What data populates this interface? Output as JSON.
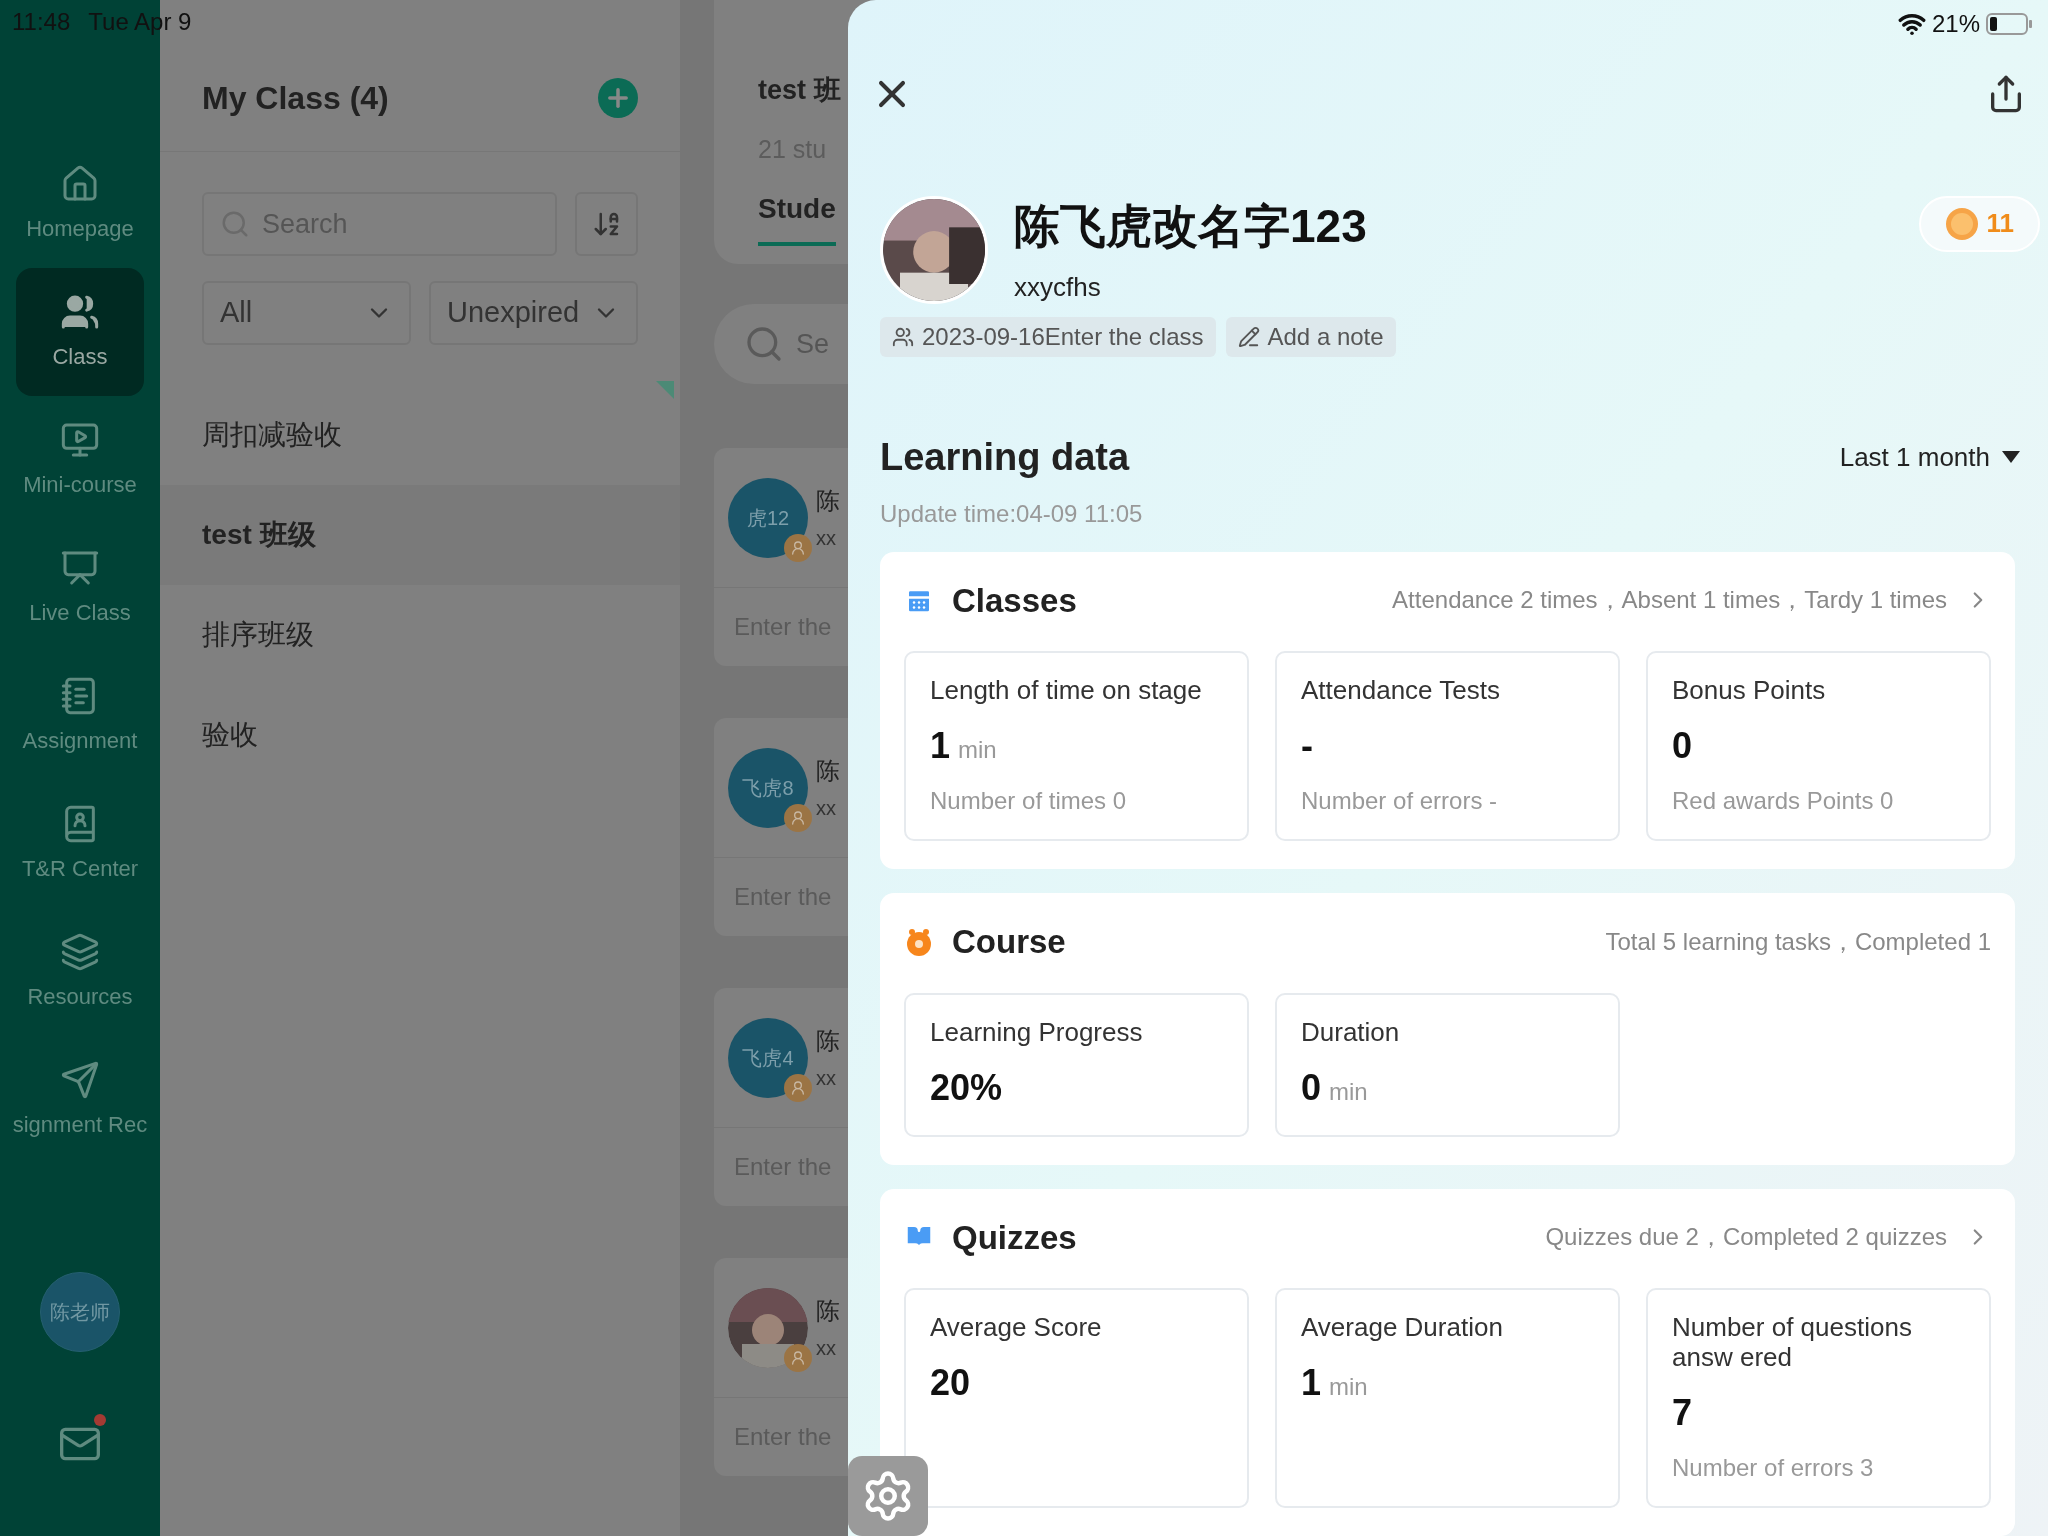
{
  "status_bar": {
    "time": "11:48",
    "date": "Tue Apr 9",
    "battery_text": "21%"
  },
  "sidebar": {
    "items": [
      {
        "label": "Homepage",
        "selected": false
      },
      {
        "label": "Class",
        "selected": true
      },
      {
        "label": "Mini-course",
        "selected": false
      },
      {
        "label": "Live Class",
        "selected": false
      },
      {
        "label": "Assignment",
        "selected": false
      },
      {
        "label": "T&R Center",
        "selected": false
      },
      {
        "label": "Resources",
        "selected": false
      },
      {
        "label": "signment Rec",
        "selected": false
      }
    ],
    "user": "陈老师",
    "mail_unread": true
  },
  "class_list": {
    "title": "My Class (4)",
    "search": {
      "placeholder": "Search"
    },
    "filters": [
      "All",
      "Unexpired"
    ],
    "items": [
      {
        "label": "周扣减验收",
        "selected": false
      },
      {
        "label": "test 班级",
        "selected": true
      },
      {
        "label": "排序班级",
        "selected": false
      },
      {
        "label": "验收",
        "selected": false
      }
    ]
  },
  "class_detail": {
    "title": "test 班",
    "count": "21 stu",
    "tab": "Stude",
    "search": {
      "placeholder": "Se"
    },
    "students": [
      {
        "avatar": "虎12",
        "name": "陈",
        "id": "xx",
        "footer": "Enter the"
      },
      {
        "avatar": "飞虎8",
        "name": "陈",
        "id": "xx",
        "footer": "Enter the"
      },
      {
        "avatar": "飞虎4",
        "name": "陈",
        "id": "xx",
        "footer": "Enter the"
      },
      {
        "kind": "picture",
        "name": "陈",
        "id": "xx",
        "footer": "Enter the"
      }
    ]
  },
  "student": {
    "name": "陈飞虎改名字123",
    "account": "xxycfhs",
    "coins": "11",
    "joined": "2023-09-16Enter the class",
    "note": "Add a note",
    "learning_title": "Learning data",
    "range": "Last 1 month",
    "update_time": "Update time:04-09 11:05",
    "sections": [
      {
        "kind": "classes",
        "title": "Classes",
        "summary": "Attendance 2 times，Absent 1 times，Tardy 1 times",
        "link": true,
        "stats": [
          {
            "label": "Length of time on stage",
            "value": "1",
            "unit": "min",
            "note": "Number of times 0"
          },
          {
            "label": "Attendance Tests",
            "value": "-",
            "note": "Number of errors -"
          },
          {
            "label": "Bonus Points",
            "value": "0",
            "note": "Red awards Points 0"
          }
        ]
      },
      {
        "kind": "course",
        "title": "Course",
        "summary": "Total 5 learning tasks，Completed 1",
        "link": false,
        "stats": [
          {
            "label": "Learning Progress",
            "value": "20%"
          },
          {
            "label": "Duration",
            "value": "0",
            "unit": "min"
          }
        ]
      },
      {
        "kind": "quizzes",
        "title": "Quizzes",
        "summary": "Quizzes due 2，Completed 2 quizzes",
        "link": true,
        "stats": [
          {
            "label": "Average Score",
            "value": "20"
          },
          {
            "label": "Average Duration",
            "value": "1",
            "unit": "min"
          },
          {
            "label": "Number of questions answ ered",
            "value": "7",
            "note": "Number of errors 3"
          }
        ]
      }
    ]
  }
}
